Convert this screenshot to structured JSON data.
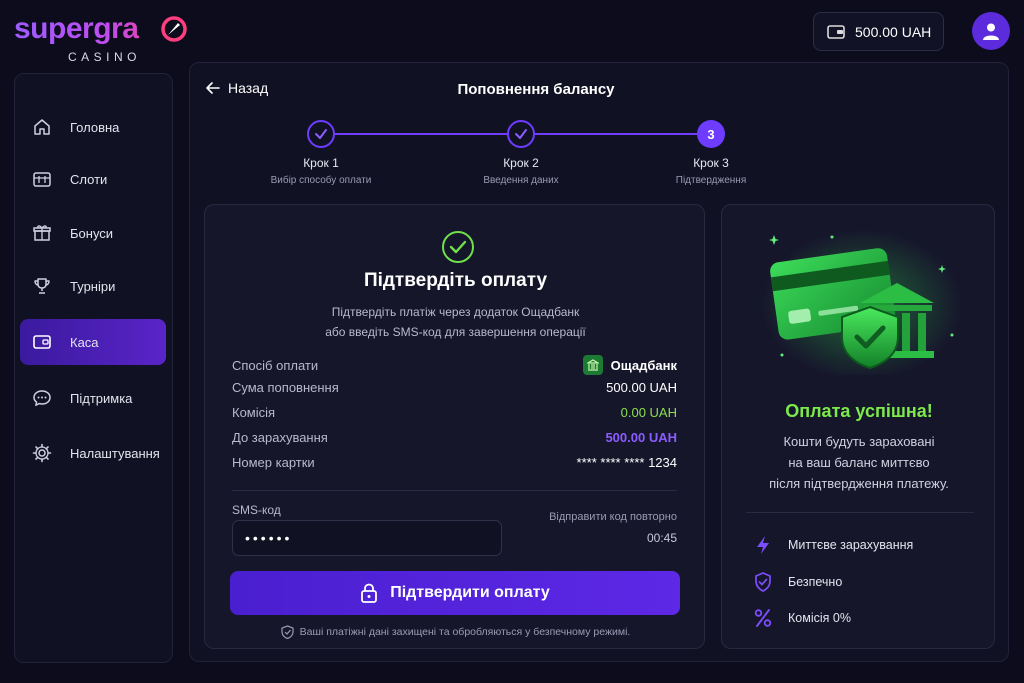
{
  "brand": {
    "name": "supergra",
    "sub": "CASINO"
  },
  "header": {
    "balance": "500.00 UAH"
  },
  "sidebar": {
    "items": [
      {
        "label": "Головна"
      },
      {
        "label": "Слоти"
      },
      {
        "label": "Бонуси"
      },
      {
        "label": "Турніри"
      },
      {
        "label": "Каса"
      },
      {
        "label": "Підтримка"
      },
      {
        "label": "Налаштування"
      }
    ],
    "active_index": 4
  },
  "page": {
    "back_label": "Назад",
    "title": "Поповнення балансу"
  },
  "stepper": {
    "steps": [
      {
        "label": "Крок 1",
        "sub": "Вибір способу оплати",
        "state": "done"
      },
      {
        "label": "Крок 2",
        "sub": "Введення даних",
        "state": "done"
      },
      {
        "label": "Крок 3",
        "sub": "Підтвердження",
        "state": "current",
        "number": "3"
      }
    ]
  },
  "confirm": {
    "title": "Підтвердіть оплату",
    "desc_line1": "Підтвердіть платіж через додаток Ощадбанк",
    "desc_line2": "або введіть SMS-код для завершення операції",
    "rows": [
      {
        "k": "Спосіб оплати",
        "v": "Ощадбанк"
      },
      {
        "k": "Сума поповнення",
        "v": "500.00 UAH"
      },
      {
        "k": "Комісія",
        "v": "0.00 UAH"
      },
      {
        "k": "До зарахування",
        "v": "500.00 UAH"
      },
      {
        "k": "Номер картки",
        "v": "**** **** **** 1234"
      }
    ],
    "sms_label": "SMS-код",
    "sms_value": "••••••",
    "resend_label": "Відправити код повторно",
    "timer": "00:45",
    "button_label": "Підтвердити оплату",
    "secure_note": "Ваші платіжні дані захищені та обробляються у безпечному режимі."
  },
  "success": {
    "title": "Оплата успішна!",
    "desc_line1": "Кошти будуть зараховані",
    "desc_line2": "на ваш баланс миттєво",
    "desc_line3": "після підтвердження платежу.",
    "features": [
      {
        "icon": "lightning-icon",
        "label": "Миттєве зарахування"
      },
      {
        "icon": "shield-check-icon",
        "label": "Безпечно"
      },
      {
        "icon": "percent-icon",
        "label": "Комісія 0%"
      }
    ]
  },
  "colors": {
    "accent": "#6d3cff",
    "success": "#7cea4a",
    "commission": "#8be04e",
    "credit": "#8b5cff",
    "background": "#0c0c1c"
  }
}
